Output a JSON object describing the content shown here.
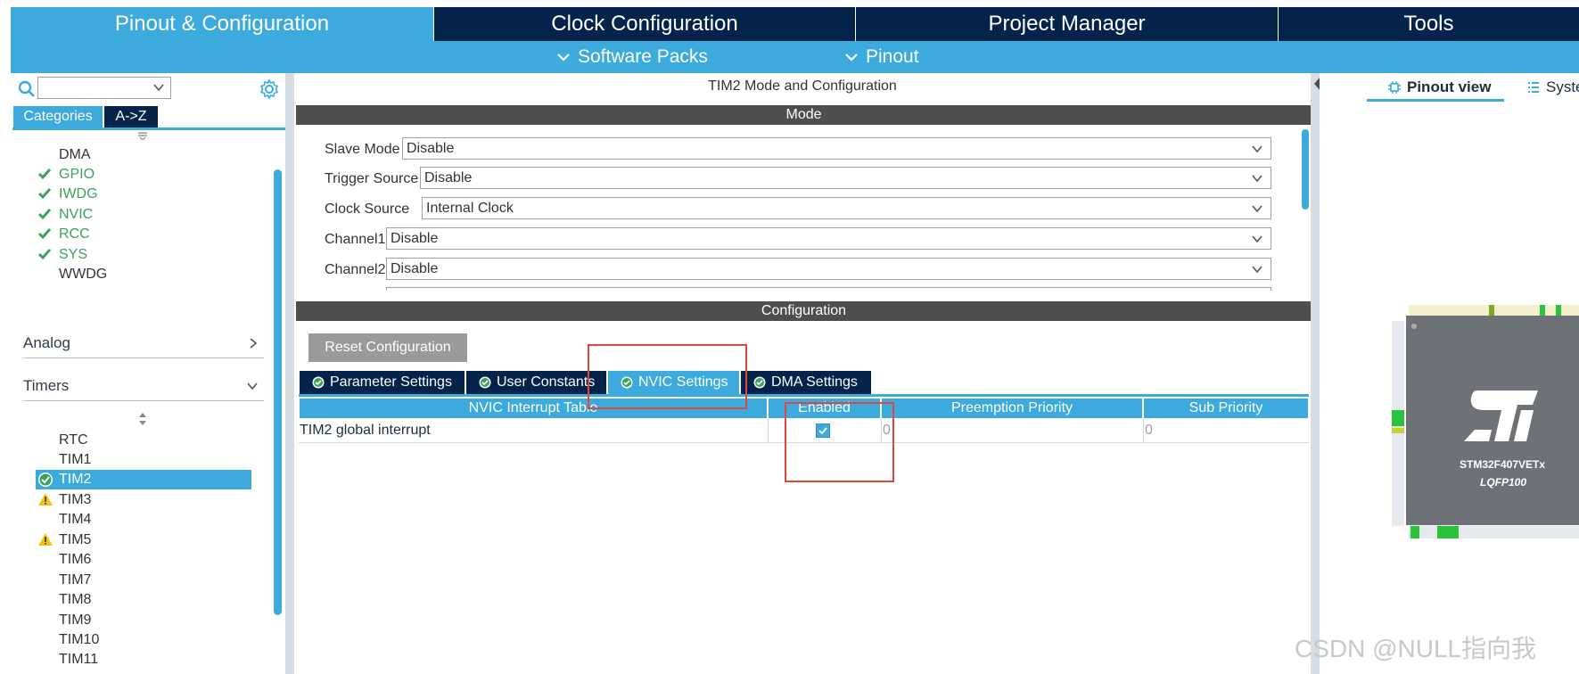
{
  "nav": {
    "tabs": [
      {
        "label": "Pinout & Configuration",
        "active": true
      },
      {
        "label": "Clock Configuration",
        "active": false
      },
      {
        "label": "Project Manager",
        "active": false
      },
      {
        "label": "Tools",
        "active": false
      }
    ],
    "sub": [
      {
        "label": "Software Packs"
      },
      {
        "label": "Pinout"
      }
    ]
  },
  "left": {
    "search_value": "",
    "category_tabs": [
      "Categories",
      "A->Z"
    ],
    "system_core_items": [
      {
        "label": "DMA",
        "status": "none"
      },
      {
        "label": "GPIO",
        "status": "ok"
      },
      {
        "label": "IWDG",
        "status": "ok"
      },
      {
        "label": "NVIC",
        "status": "ok"
      },
      {
        "label": "RCC",
        "status": "ok"
      },
      {
        "label": "SYS",
        "status": "ok"
      },
      {
        "label": "WWDG",
        "status": "none"
      }
    ],
    "analog_label": "Analog",
    "timers_label": "Timers",
    "timer_items": [
      {
        "label": "RTC",
        "status": "none"
      },
      {
        "label": "TIM1",
        "status": "none"
      },
      {
        "label": "TIM2",
        "status": "selected"
      },
      {
        "label": "TIM3",
        "status": "warning"
      },
      {
        "label": "TIM4",
        "status": "none"
      },
      {
        "label": "TIM5",
        "status": "warning"
      },
      {
        "label": "TIM6",
        "status": "none"
      },
      {
        "label": "TIM7",
        "status": "none"
      },
      {
        "label": "TIM8",
        "status": "none"
      },
      {
        "label": "TIM9",
        "status": "none"
      },
      {
        "label": "TIM10",
        "status": "none"
      },
      {
        "label": "TIM11",
        "status": "none"
      }
    ]
  },
  "center": {
    "title": "TIM2 Mode and Configuration",
    "mode_header": "Mode",
    "mode_fields": [
      {
        "label": "Slave Mode",
        "value": "Disable"
      },
      {
        "label": "Trigger Source",
        "value": "Disable"
      },
      {
        "label": "Clock Source",
        "value": "Internal Clock"
      },
      {
        "label": "Channel1",
        "value": "Disable"
      },
      {
        "label": "Channel2",
        "value": "Disable"
      }
    ],
    "config_header": "Configuration",
    "reset_button": "Reset Configuration",
    "config_tabs": [
      {
        "label": "Parameter Settings",
        "active": false
      },
      {
        "label": "User Constants",
        "active": false
      },
      {
        "label": "NVIC Settings",
        "active": true
      },
      {
        "label": "DMA Settings",
        "active": false
      }
    ],
    "table": {
      "headers": [
        "NVIC Interrupt Table",
        "Enabled",
        "Preemption Priority",
        "Sub Priority"
      ],
      "rows": [
        {
          "name": "TIM2 global interrupt",
          "enabled": true,
          "preemption": "0",
          "sub": "0"
        }
      ]
    }
  },
  "right": {
    "tabs": [
      "Pinout view",
      "Syste"
    ],
    "chip_name": "STM32F407VETx",
    "package": "LQFP100"
  },
  "watermark": "CSDN @NULL指向我",
  "colors": {
    "accent": "#3caadc",
    "navy": "#03234b",
    "ok_green": "#3aa25a",
    "warning_yellow": "#f1c40f",
    "highlight_red": "#e2453c"
  }
}
